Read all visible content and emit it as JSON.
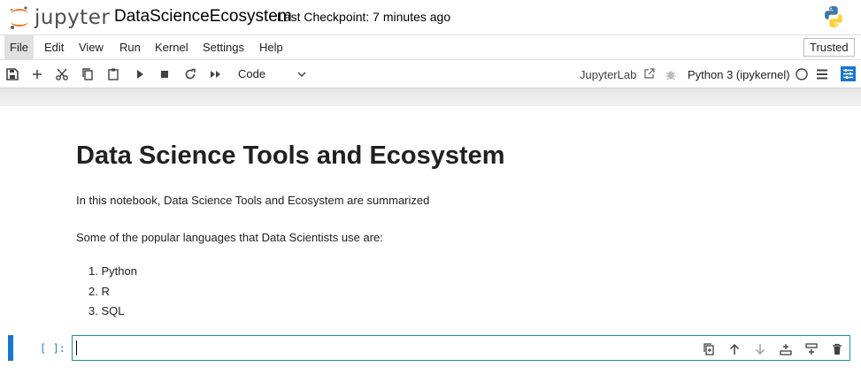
{
  "header": {
    "logo_text": "jupyter",
    "notebook_title": "DataScienceEcosystem",
    "checkpoint": "Last Checkpoint: 7 minutes ago"
  },
  "menu": {
    "items": [
      "File",
      "Edit",
      "View",
      "Run",
      "Kernel",
      "Settings",
      "Help"
    ],
    "trusted": "Trusted"
  },
  "toolbar": {
    "cell_type": "Code",
    "jupyterlab_link": "JupyterLab",
    "kernel": "Python 3 (ipykernel)",
    "icons": [
      "save-icon",
      "add-icon",
      "cut-icon",
      "copy-icon",
      "paste-icon",
      "run-icon",
      "stop-icon",
      "restart-icon",
      "fast-forward-icon"
    ]
  },
  "notebook": {
    "heading": "Data Science Tools and Ecosystem",
    "intro": "In this notebook, Data Science Tools and Ecosystem are summarized",
    "languages_intro": "Some of the popular languages that Data Scientists use are:",
    "languages": [
      "1. Python",
      "2. R",
      "3. SQL"
    ],
    "code_prompt": "[ ]:",
    "code_value": ""
  },
  "colors": {
    "accent": "#1976d2",
    "jupyter_orange": "#f37726",
    "cell_border": "#1e88a8",
    "prompt": "#307fc1"
  }
}
